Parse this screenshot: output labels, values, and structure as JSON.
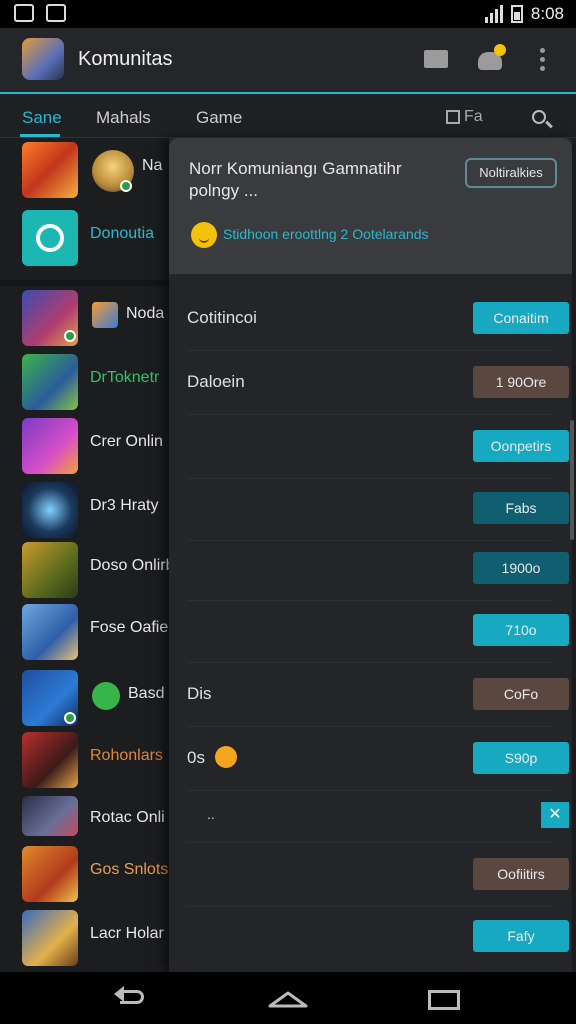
{
  "status_bar": {
    "time": "8:08"
  },
  "app_bar": {
    "title": "Komunitas",
    "icons": [
      "messages-icon",
      "groups-icon",
      "more-vert-icon"
    ],
    "notification_color": "#f4c20d"
  },
  "tabs": [
    {
      "label": "Sane",
      "active": true
    },
    {
      "label": "Mahals",
      "active": false
    },
    {
      "label": "Game",
      "active": false
    },
    {
      "label": "Fa",
      "active": false
    }
  ],
  "list": [
    {
      "label": "Na",
      "highlight": false
    },
    {
      "label": "Donoutia",
      "highlight": true
    },
    {
      "label": "Noda",
      "highlight": false
    },
    {
      "label": "DrToknetr",
      "highlight": true
    },
    {
      "label": "Crer Onlin",
      "highlight": false
    },
    {
      "label": "Dr3  Hraty",
      "highlight": false
    },
    {
      "label": "Doso Onlirb",
      "highlight": false
    },
    {
      "label": "Fose Oafie",
      "highlight": false
    },
    {
      "label": "Basd",
      "highlight": false
    },
    {
      "label": "Rohonlars",
      "highlight": false
    },
    {
      "label": "Rotac Onli",
      "highlight": false
    },
    {
      "label": "Gos Snlots",
      "highlight": false
    },
    {
      "label": "Lacr Holar",
      "highlight": false
    }
  ],
  "overlay": {
    "title": "Norr Komuniangı Gamnatihr polngy ...",
    "action_label": "Noltiralkies",
    "subtitle": "Stidhoon eroottlng 2 Ootelarands",
    "rows": [
      {
        "label": "Cotitincoi",
        "button": "Conaitim",
        "style": "teal"
      },
      {
        "label": "Daloein",
        "button": "1 90Ore",
        "style": "brown"
      },
      {
        "label": "",
        "button": "Oonpetirs",
        "style": "teal"
      },
      {
        "label": "",
        "button": "Fabs",
        "style": "dteal"
      },
      {
        "label": "",
        "button": "1900o",
        "style": "dteal"
      },
      {
        "label": "",
        "button": "710o",
        "style": "teal"
      },
      {
        "label": "Dis",
        "button": "CoFo",
        "style": "brown"
      },
      {
        "label": "0s",
        "button": "S90p",
        "style": "teal"
      },
      {
        "label": "..",
        "button": "✕",
        "style": "check"
      },
      {
        "label": "",
        "button": "Oofiitirs",
        "style": "brown"
      },
      {
        "label": "",
        "button": "Fafy",
        "style": "teal"
      }
    ]
  }
}
